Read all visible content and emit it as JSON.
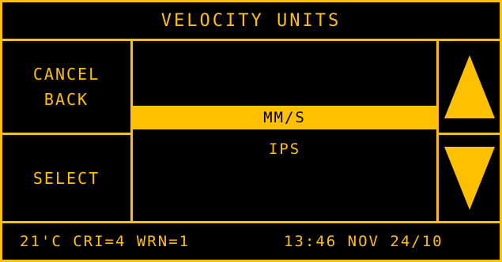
{
  "title": "VELOCITY UNITS",
  "buttons": {
    "cancel_line1": "CANCEL",
    "cancel_line2": "BACK",
    "select": "SELECT"
  },
  "list": {
    "items": [
      {
        "label": "MM/S",
        "selected": true
      },
      {
        "label": "IPS",
        "selected": false
      }
    ]
  },
  "icons": {
    "scroll_up": "triangle-up-icon",
    "scroll_down": "triangle-down-icon"
  },
  "status": {
    "left": "21'C CRI=4 WRN=1",
    "right": "13:46 NOV 24/10"
  },
  "colors": {
    "accent": "#FFC000",
    "background": "#000000"
  }
}
